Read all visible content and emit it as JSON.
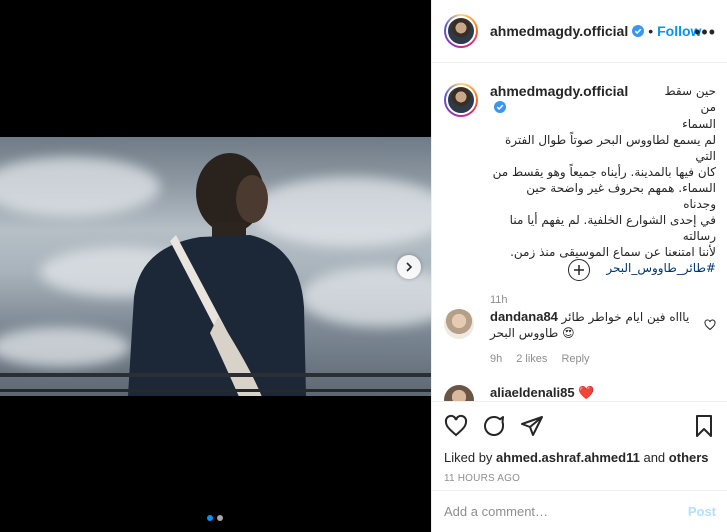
{
  "post": {
    "username": "ahmedmagdy.official",
    "follow_label": "Follow",
    "separator": "•",
    "more_label": "•••"
  },
  "caption": {
    "username": "ahmedmagdy.official",
    "lines": [
      "حين سقط من",
      "السماء",
      "لم يسمع لطاووس البحر صوتاً طوال الفترة التي",
      "كان فيها بالمدينة. رأيناه جميعاً وهو يقسط من",
      "السماء. همهم بحروف غير واضحة حين وجدناه",
      "في إحدى الشوارع الخلفية. لم يفهم أيا منا رسالته",
      "لأننا امتنعنا عن سماع الموسيقى منذ زمن."
    ],
    "hashtag": "#طائر_طاووس_البحر",
    "time": "11h"
  },
  "comments": [
    {
      "username": "dandana84",
      "text": "ياااه فين ايام خواطر طائر طاووس البحر 😍",
      "time": "9h",
      "likes": "2 likes",
      "reply": "Reply"
    },
    {
      "username": "aliaeldenali85",
      "text": "❤️",
      "time": "",
      "likes": "",
      "reply": ""
    }
  ],
  "actions": {
    "liked_by_prefix": "Liked by",
    "liked_by_user": "ahmed.ashraf.ahmed11",
    "liked_by_and": "and",
    "liked_by_others": "others",
    "timestamp": "11 HOURS AGO"
  },
  "add_comment": {
    "placeholder": "Add a comment…",
    "post_label": "Post"
  },
  "icons": [
    "verified-badge-icon",
    "more-options-icon",
    "carousel-next-icon",
    "load-more-comments-icon",
    "comment-like-heart-icon",
    "like-heart-icon",
    "comment-bubble-icon",
    "share-send-icon",
    "save-bookmark-icon"
  ],
  "colors": {
    "accent": "#0095f6",
    "post_disabled": "#b2dffc",
    "muted_text": "#8e8e8e",
    "hashtag": "#00376b"
  },
  "carousel": {
    "slide_count": 2,
    "active_slide": 1
  }
}
